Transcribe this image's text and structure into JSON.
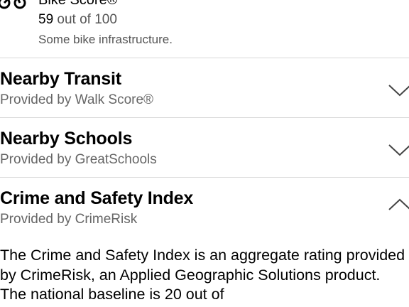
{
  "bike": {
    "title": "Bike Score®",
    "score_value": "59",
    "score_suffix": "out of 100",
    "description": "Some bike infrastructure."
  },
  "sections": [
    {
      "title": "Nearby Transit",
      "subtitle": "Provided by Walk Score®",
      "state": "collapsed"
    },
    {
      "title": "Nearby Schools",
      "subtitle": "Provided by GreatSchools",
      "state": "collapsed"
    },
    {
      "title": "Crime and Safety Index",
      "subtitle": "Provided by CrimeRisk",
      "state": "expanded"
    }
  ],
  "crime_body": "The Crime and Safety Index is an aggregate rating provided by CrimeRisk, an Applied Geographic Solutions product. The national baseline is 20 out of"
}
